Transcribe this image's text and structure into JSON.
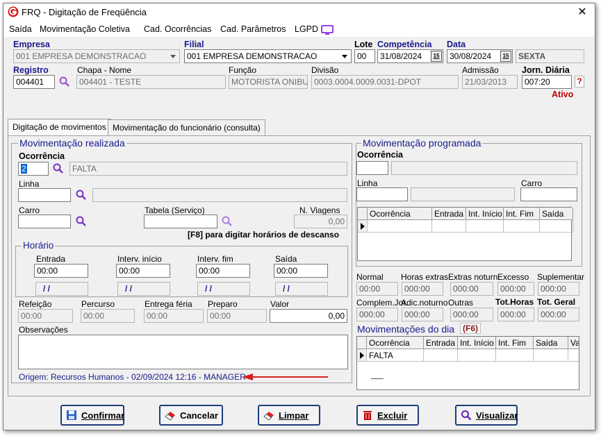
{
  "window": {
    "title": "FRQ - Digitação de Freqüência",
    "close": "✕"
  },
  "menu": {
    "saida": "Saída",
    "mov_coletiva": "Movimentação Coletiva",
    "cad_ocorrencias": "Cad. Ocorrências",
    "cad_parametros": "Cad. Parâmetros",
    "lgpd": "LGPD"
  },
  "header": {
    "empresa_label": "Empresa",
    "empresa_value": "001 EMPRESA DEMONSTRACAO",
    "filial_label": "Filial",
    "filial_value": "001 EMPRESA DEMONSTRACAO",
    "lote_label": "Lote",
    "lote_value": "00",
    "competencia_label": "Competência",
    "competencia_value": "31/08/2024",
    "data_label": "Data",
    "data_value": "30/08/2024",
    "dia_semana": "SEXTA",
    "cal_glyph": "15",
    "registro_label": "Registro",
    "registro_value": "004401",
    "chapa_nome_label": "Chapa  -  Nome",
    "chapa_nome_value": "004401 - TESTE",
    "funcao_label": "Função",
    "funcao_value": "MOTORISTA ONIBU",
    "divisao_label": "Divisão",
    "divisao_value": "0003.0004.0009.0031-DPOT",
    "admissao_label": "Admissão",
    "admissao_value": "21/03/2013",
    "jorn_label": "Jorn. Diária",
    "jorn_value": "007:20",
    "help": "?",
    "status": "Ativo"
  },
  "tabs": [
    "Digitação de movimentos",
    "Movimentação do funcionário (consulta)"
  ],
  "realizada": {
    "title": "Movimentação realizada",
    "ocorrencia_label": "Ocorrência",
    "ocorrencia_code": "2",
    "ocorrencia_desc": "FALTA",
    "linha_label": "Linha",
    "carro_label": "Carro",
    "tabela_label": "Tabela (Serviço)",
    "viagens_label": "N. Viagens",
    "viagens_value": "0,00",
    "f8_hint": "[F8] para digitar horários de descanso",
    "horario_title": "Horário",
    "entrada_label": "Entrada",
    "entrada_value": "00:00",
    "interv_ini_label": "Interv. início",
    "interv_ini_value": "00:00",
    "interv_fim_label": "Interv. fim",
    "interv_fim_value": "00:00",
    "saida_label": "Saída",
    "saida_value": "00:00",
    "date_placeholder": "/ /",
    "refeicao_label": "Refeição",
    "refeicao_value": "00:00",
    "percurso_label": "Percurso",
    "percurso_value": "00:00",
    "entrega_label": "Entrega féria",
    "entrega_value": "00:00",
    "preparo_label": "Preparo",
    "preparo_value": "00:00",
    "valor_label": "Valor",
    "valor_value": "0,00",
    "obs_label": "Observações",
    "origem": "Origem: Recursos Humanos - 02/09/2024 12:16 - MANAGER"
  },
  "programada": {
    "title": "Movimentação programada",
    "ocorrencia_label": "Ocorrência",
    "linha_label": "Linha",
    "carro_label": "Carro",
    "grid_headers": [
      "Ocorrência",
      "Entrada",
      "Int. Início",
      "Int. Fim",
      "Saída"
    ]
  },
  "totais": {
    "labels1": [
      "Normal",
      "Horas extras",
      "Extras noturn.",
      "Excesso",
      "Suplementar"
    ],
    "values1": [
      "00:00",
      "000:00",
      "000:00",
      "000:00",
      "000:00"
    ],
    "labels2": [
      "Complem.Jor.",
      "Adic.noturno",
      "Outras",
      "Tot.Horas",
      "Tot. Geral"
    ],
    "values2": [
      "000:00",
      "000:00",
      "000:00",
      "000:00",
      "000:00"
    ]
  },
  "dia": {
    "title": "Movimentações do dia",
    "hotkey": "(F6)",
    "grid_headers": [
      "Ocorrência",
      "Entrada",
      "Int. Início",
      "Int. Fim",
      "Saída",
      "Va"
    ],
    "rows": [
      [
        "FALTA",
        "",
        "",
        "",
        "",
        ""
      ]
    ]
  },
  "buttons": {
    "confirmar": "Confirmar",
    "cancelar": "Cancelar",
    "limpar": "Limpar",
    "excluir": "Excluir",
    "visualizar": "Visualizar"
  },
  "colors": {
    "accent": "#1a1a8c",
    "red": "#c00000",
    "arrow": "#d42020"
  }
}
